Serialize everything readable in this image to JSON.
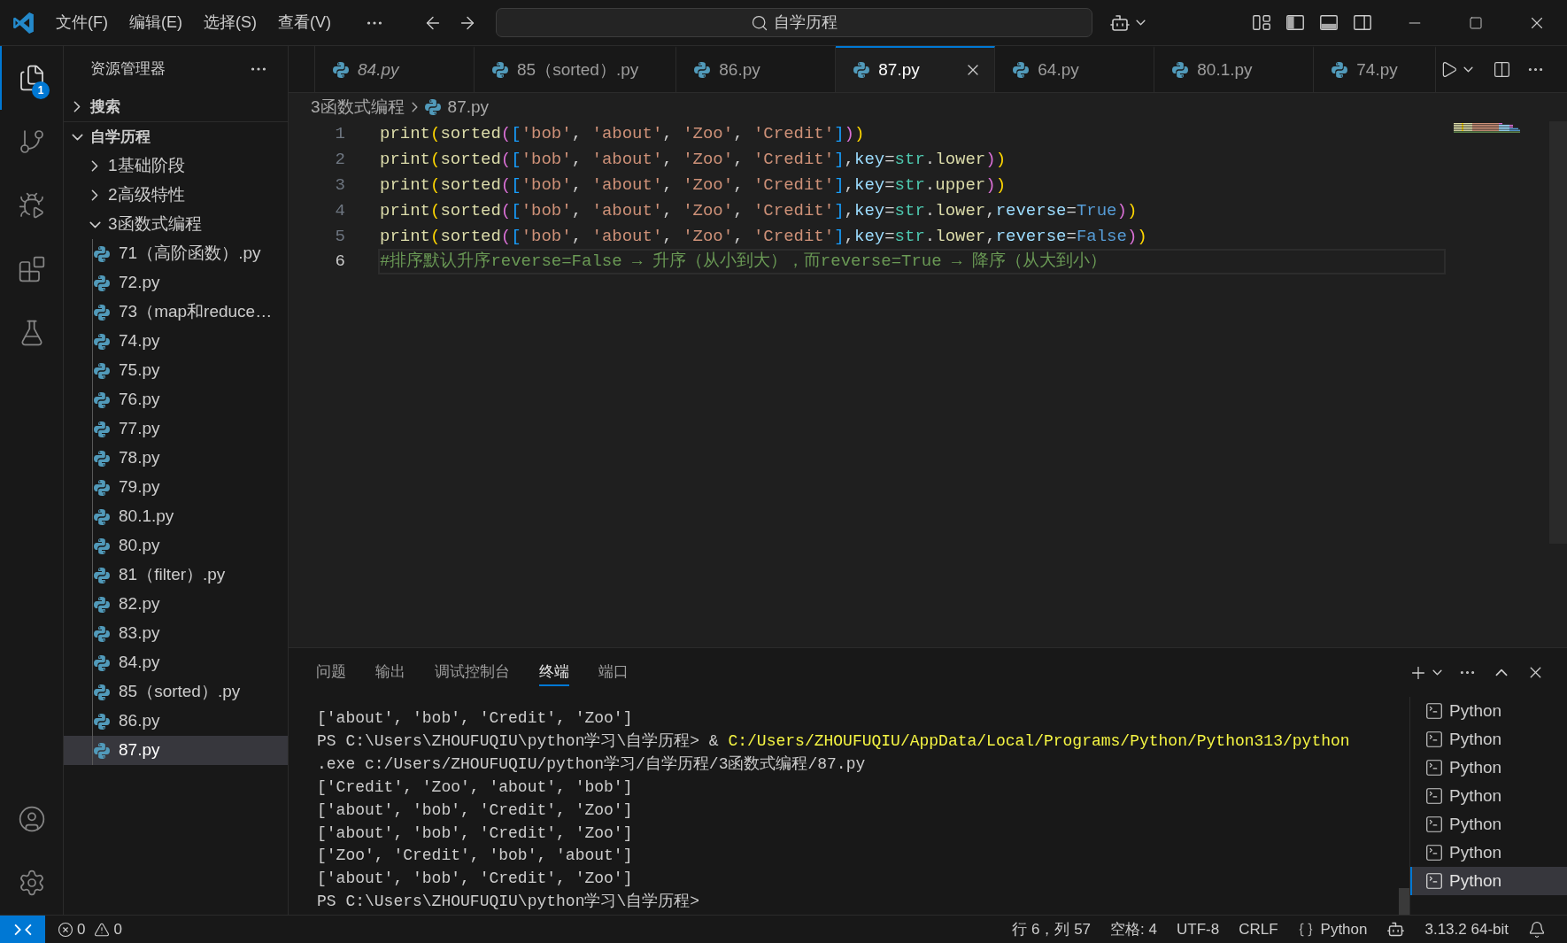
{
  "title_bar": {
    "menus": [
      "文件(F)",
      "编辑(E)",
      "选择(S)",
      "查看(V)"
    ],
    "search": {
      "value": "自学历程"
    }
  },
  "activity_bar": {
    "items": [
      {
        "kind": "explorer",
        "selected": true,
        "badge": "1"
      },
      {
        "kind": "scm",
        "selected": false
      },
      {
        "kind": "debug",
        "selected": false
      },
      {
        "kind": "extensions",
        "selected": false
      },
      {
        "kind": "testing",
        "selected": false
      }
    ]
  },
  "sidebar": {
    "title": "资源管理器",
    "tree": [
      {
        "kind": "section",
        "label": "搜索",
        "expanded": false,
        "selected": false
      },
      {
        "kind": "section",
        "label": "自学历程",
        "expanded": true,
        "selected": false,
        "children": [
          {
            "kind": "folder",
            "label": "1基础阶段",
            "expanded": false,
            "selected": false
          },
          {
            "kind": "folder",
            "label": "2高级特性",
            "expanded": false,
            "selected": false
          },
          {
            "kind": "folder",
            "label": "3函数式编程",
            "expanded": true,
            "selected": false,
            "children": [
              {
                "kind": "file",
                "label": "71（高阶函数）.py",
                "selected": false
              },
              {
                "kind": "file",
                "label": "72.py",
                "selected": false
              },
              {
                "kind": "file",
                "label": "73（map和reduce…",
                "selected": false
              },
              {
                "kind": "file",
                "label": "74.py",
                "selected": false
              },
              {
                "kind": "file",
                "label": "75.py",
                "selected": false
              },
              {
                "kind": "file",
                "label": "76.py",
                "selected": false
              },
              {
                "kind": "file",
                "label": "77.py",
                "selected": false
              },
              {
                "kind": "file",
                "label": "78.py",
                "selected": false
              },
              {
                "kind": "file",
                "label": "79.py",
                "selected": false
              },
              {
                "kind": "file",
                "label": "80.1.py",
                "selected": false
              },
              {
                "kind": "file",
                "label": "80.py",
                "selected": false
              },
              {
                "kind": "file",
                "label": "81（filter）.py",
                "selected": false
              },
              {
                "kind": "file",
                "label": "82.py",
                "selected": false
              },
              {
                "kind": "file",
                "label": "83.py",
                "selected": false
              },
              {
                "kind": "file",
                "label": "84.py",
                "selected": false
              },
              {
                "kind": "file",
                "label": "85（sorted）.py",
                "selected": false
              },
              {
                "kind": "file",
                "label": "86.py",
                "selected": false
              },
              {
                "kind": "file",
                "label": "87.py",
                "selected": true
              }
            ]
          }
        ]
      }
    ]
  },
  "editor": {
    "tabs": [
      {
        "label": "84.py",
        "selected": false,
        "preview": true
      },
      {
        "label": "85（sorted）.py",
        "selected": false,
        "preview": false
      },
      {
        "label": "86.py",
        "selected": false,
        "preview": false
      },
      {
        "label": "87.py",
        "selected": true,
        "preview": false
      },
      {
        "label": "64.py",
        "selected": false,
        "preview": false
      },
      {
        "label": "80.1.py",
        "selected": false,
        "preview": false
      },
      {
        "label": "74.py",
        "selected": false,
        "preview": false
      }
    ],
    "breadcrumb": [
      {
        "kind": "folder",
        "label": "3函数式编程"
      },
      {
        "kind": "file",
        "label": "87.py"
      }
    ],
    "lines": [
      {
        "number": "1",
        "active": false,
        "tokens": [
          {
            "text": "print",
            "kind": "function"
          },
          {
            "text": "(",
            "kind": "bracket1"
          },
          {
            "text": "sorted",
            "kind": "function"
          },
          {
            "text": "(",
            "kind": "bracket2"
          },
          {
            "text": "[",
            "kind": "bracket3"
          },
          {
            "text": "'bob'",
            "kind": "string"
          },
          {
            "text": ", ",
            "kind": "punctuation"
          },
          {
            "text": "'about'",
            "kind": "string"
          },
          {
            "text": ", ",
            "kind": "punctuation"
          },
          {
            "text": "'Zoo'",
            "kind": "string"
          },
          {
            "text": ", ",
            "kind": "punctuation"
          },
          {
            "text": "'Credit'",
            "kind": "string"
          },
          {
            "text": "]",
            "kind": "bracket3"
          },
          {
            "text": ")",
            "kind": "bracket2"
          },
          {
            "text": ")",
            "kind": "bracket1"
          }
        ]
      },
      {
        "number": "2",
        "active": false,
        "tokens": [
          {
            "text": "print",
            "kind": "function"
          },
          {
            "text": "(",
            "kind": "bracket1"
          },
          {
            "text": "sorted",
            "kind": "function"
          },
          {
            "text": "(",
            "kind": "bracket2"
          },
          {
            "text": "[",
            "kind": "bracket3"
          },
          {
            "text": "'bob'",
            "kind": "string"
          },
          {
            "text": ", ",
            "kind": "punctuation"
          },
          {
            "text": "'about'",
            "kind": "string"
          },
          {
            "text": ", ",
            "kind": "punctuation"
          },
          {
            "text": "'Zoo'",
            "kind": "string"
          },
          {
            "text": ", ",
            "kind": "punctuation"
          },
          {
            "text": "'Credit'",
            "kind": "string"
          },
          {
            "text": "]",
            "kind": "bracket3"
          },
          {
            "text": ",",
            "kind": "punctuation"
          },
          {
            "text": "key",
            "kind": "parameter"
          },
          {
            "text": "=",
            "kind": "operator"
          },
          {
            "text": "str",
            "kind": "class"
          },
          {
            "text": ".",
            "kind": "punctuation"
          },
          {
            "text": "lower",
            "kind": "method"
          },
          {
            "text": ")",
            "kind": "bracket2"
          },
          {
            "text": ")",
            "kind": "bracket1"
          }
        ]
      },
      {
        "number": "3",
        "active": false,
        "tokens": [
          {
            "text": "print",
            "kind": "function"
          },
          {
            "text": "(",
            "kind": "bracket1"
          },
          {
            "text": "sorted",
            "kind": "function"
          },
          {
            "text": "(",
            "kind": "bracket2"
          },
          {
            "text": "[",
            "kind": "bracket3"
          },
          {
            "text": "'bob'",
            "kind": "string"
          },
          {
            "text": ", ",
            "kind": "punctuation"
          },
          {
            "text": "'about'",
            "kind": "string"
          },
          {
            "text": ", ",
            "kind": "punctuation"
          },
          {
            "text": "'Zoo'",
            "kind": "string"
          },
          {
            "text": ", ",
            "kind": "punctuation"
          },
          {
            "text": "'Credit'",
            "kind": "string"
          },
          {
            "text": "]",
            "kind": "bracket3"
          },
          {
            "text": ",",
            "kind": "punctuation"
          },
          {
            "text": "key",
            "kind": "parameter"
          },
          {
            "text": "=",
            "kind": "operator"
          },
          {
            "text": "str",
            "kind": "class"
          },
          {
            "text": ".",
            "kind": "punctuation"
          },
          {
            "text": "upper",
            "kind": "method"
          },
          {
            "text": ")",
            "kind": "bracket2"
          },
          {
            "text": ")",
            "kind": "bracket1"
          }
        ]
      },
      {
        "number": "4",
        "active": false,
        "tokens": [
          {
            "text": "print",
            "kind": "function"
          },
          {
            "text": "(",
            "kind": "bracket1"
          },
          {
            "text": "sorted",
            "kind": "function"
          },
          {
            "text": "(",
            "kind": "bracket2"
          },
          {
            "text": "[",
            "kind": "bracket3"
          },
          {
            "text": "'bob'",
            "kind": "string"
          },
          {
            "text": ", ",
            "kind": "punctuation"
          },
          {
            "text": "'about'",
            "kind": "string"
          },
          {
            "text": ", ",
            "kind": "punctuation"
          },
          {
            "text": "'Zoo'",
            "kind": "string"
          },
          {
            "text": ", ",
            "kind": "punctuation"
          },
          {
            "text": "'Credit'",
            "kind": "string"
          },
          {
            "text": "]",
            "kind": "bracket3"
          },
          {
            "text": ",",
            "kind": "punctuation"
          },
          {
            "text": "key",
            "kind": "parameter"
          },
          {
            "text": "=",
            "kind": "operator"
          },
          {
            "text": "str",
            "kind": "class"
          },
          {
            "text": ".",
            "kind": "punctuation"
          },
          {
            "text": "lower",
            "kind": "method"
          },
          {
            "text": ",",
            "kind": "punctuation"
          },
          {
            "text": "reverse",
            "kind": "parameter"
          },
          {
            "text": "=",
            "kind": "operator"
          },
          {
            "text": "True",
            "kind": "constant"
          },
          {
            "text": ")",
            "kind": "bracket2"
          },
          {
            "text": ")",
            "kind": "bracket1"
          }
        ]
      },
      {
        "number": "5",
        "active": false,
        "tokens": [
          {
            "text": "print",
            "kind": "function"
          },
          {
            "text": "(",
            "kind": "bracket1"
          },
          {
            "text": "sorted",
            "kind": "function"
          },
          {
            "text": "(",
            "kind": "bracket2"
          },
          {
            "text": "[",
            "kind": "bracket3"
          },
          {
            "text": "'bob'",
            "kind": "string"
          },
          {
            "text": ", ",
            "kind": "punctuation"
          },
          {
            "text": "'about'",
            "kind": "string"
          },
          {
            "text": ", ",
            "kind": "punctuation"
          },
          {
            "text": "'Zoo'",
            "kind": "string"
          },
          {
            "text": ", ",
            "kind": "punctuation"
          },
          {
            "text": "'Credit'",
            "kind": "string"
          },
          {
            "text": "]",
            "kind": "bracket3"
          },
          {
            "text": ",",
            "kind": "punctuation"
          },
          {
            "text": "key",
            "kind": "parameter"
          },
          {
            "text": "=",
            "kind": "operator"
          },
          {
            "text": "str",
            "kind": "class"
          },
          {
            "text": ".",
            "kind": "punctuation"
          },
          {
            "text": "lower",
            "kind": "method"
          },
          {
            "text": ",",
            "kind": "punctuation"
          },
          {
            "text": "reverse",
            "kind": "parameter"
          },
          {
            "text": "=",
            "kind": "operator"
          },
          {
            "text": "False",
            "kind": "constant"
          },
          {
            "text": ")",
            "kind": "bracket2"
          },
          {
            "text": ")",
            "kind": "bracket1"
          }
        ]
      },
      {
        "number": "6",
        "active": true,
        "tokens": [
          {
            "text": "#排序默认升序reverse=False → 升序（从小到大），而reverse=True → 降序（从大到小）",
            "kind": "comment"
          }
        ]
      }
    ]
  },
  "panel": {
    "tabs": [
      {
        "label": "问题",
        "selected": false
      },
      {
        "label": "输出",
        "selected": false
      },
      {
        "label": "调试控制台",
        "selected": false
      },
      {
        "label": "终端",
        "selected": true
      },
      {
        "label": "端口",
        "selected": false
      }
    ],
    "terminal": {
      "lines": [
        {
          "segments": [
            {
              "text": "['about', 'bob', 'Credit', 'Zoo']",
              "kind": "output"
            }
          ]
        },
        {
          "segments": [
            {
              "text": "PS C:\\Users\\ZHOUFUQIU\\python学习\\自学历程> & ",
              "kind": "output"
            },
            {
              "text": "C:/Users/ZHOUFUQIU/AppData/Local/Programs/Python/Python313/python",
              "kind": "command"
            }
          ]
        },
        {
          "segments": [
            {
              "text": ".exe c:/Users/ZHOUFUQIU/python学习/自学历程/3函数式编程/87.py",
              "kind": "output"
            }
          ]
        },
        {
          "segments": [
            {
              "text": "['Credit', 'Zoo', 'about', 'bob']",
              "kind": "output"
            }
          ]
        },
        {
          "segments": [
            {
              "text": "['about', 'bob', 'Credit', 'Zoo']",
              "kind": "output"
            }
          ]
        },
        {
          "segments": [
            {
              "text": "['about', 'bob', 'Credit', 'Zoo']",
              "kind": "output"
            }
          ]
        },
        {
          "segments": [
            {
              "text": "['Zoo', 'Credit', 'bob', 'about']",
              "kind": "output"
            }
          ]
        },
        {
          "segments": [
            {
              "text": "['about', 'bob', 'Credit', 'Zoo']",
              "kind": "output"
            }
          ]
        },
        {
          "segments": [
            {
              "text": "PS C:\\Users\\ZHOUFUQIU\\python学习\\自学历程>",
              "kind": "output"
            }
          ]
        }
      ],
      "sessions": [
        {
          "label": "Python",
          "selected": false
        },
        {
          "label": "Python",
          "selected": false
        },
        {
          "label": "Python",
          "selected": false
        },
        {
          "label": "Python",
          "selected": false
        },
        {
          "label": "Python",
          "selected": false
        },
        {
          "label": "Python",
          "selected": false
        },
        {
          "label": "Python",
          "selected": true
        }
      ]
    }
  },
  "status_bar": {
    "problems": {
      "errors": "0",
      "warnings": "0"
    },
    "items": [
      {
        "kind": "text",
        "label": "行 6，列 57"
      },
      {
        "kind": "text",
        "label": "空格: 4"
      },
      {
        "kind": "text",
        "label": "UTF-8"
      },
      {
        "kind": "text",
        "label": "CRLF"
      },
      {
        "kind": "language",
        "label": "Python"
      },
      {
        "kind": "assistant"
      },
      {
        "kind": "text",
        "label": "3.13.2 64-bit"
      },
      {
        "kind": "notifications"
      }
    ]
  }
}
